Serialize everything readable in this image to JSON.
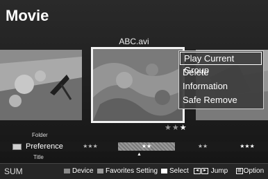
{
  "header": {
    "title": "Movie"
  },
  "current_file": {
    "name": "ABC.avi"
  },
  "context_menu": {
    "items": [
      {
        "label": "Play Current Group",
        "selected": true
      },
      {
        "label": "Delete",
        "selected": false
      },
      {
        "label": "Information",
        "selected": false
      },
      {
        "label": "Safe Remove",
        "selected": false
      }
    ]
  },
  "rating": {
    "stars_total": 3,
    "stars_on": 1,
    "star_glyph": "★"
  },
  "sort_categories": {
    "above": "Folder",
    "current": "Preference",
    "below": "Title"
  },
  "preference_segments": [
    {
      "stars": "★★★",
      "active": false
    },
    {
      "stars": "★★",
      "active": true
    },
    {
      "stars": "★★",
      "active": false
    },
    {
      "stars": "★★★",
      "active": false
    }
  ],
  "preference_marker": "▲",
  "bottom_bar": {
    "sum_label": "SUM",
    "device_label": "Device",
    "favorites_label": "Favorites Setting",
    "select_label": "Select",
    "jump_label": "Jump",
    "jump_keys": [
      "◄",
      "►"
    ],
    "option_label": "Option",
    "colors": {
      "device": "#8a8a8a",
      "favorites": "#9a9a9a",
      "select": "#ffffff"
    }
  }
}
